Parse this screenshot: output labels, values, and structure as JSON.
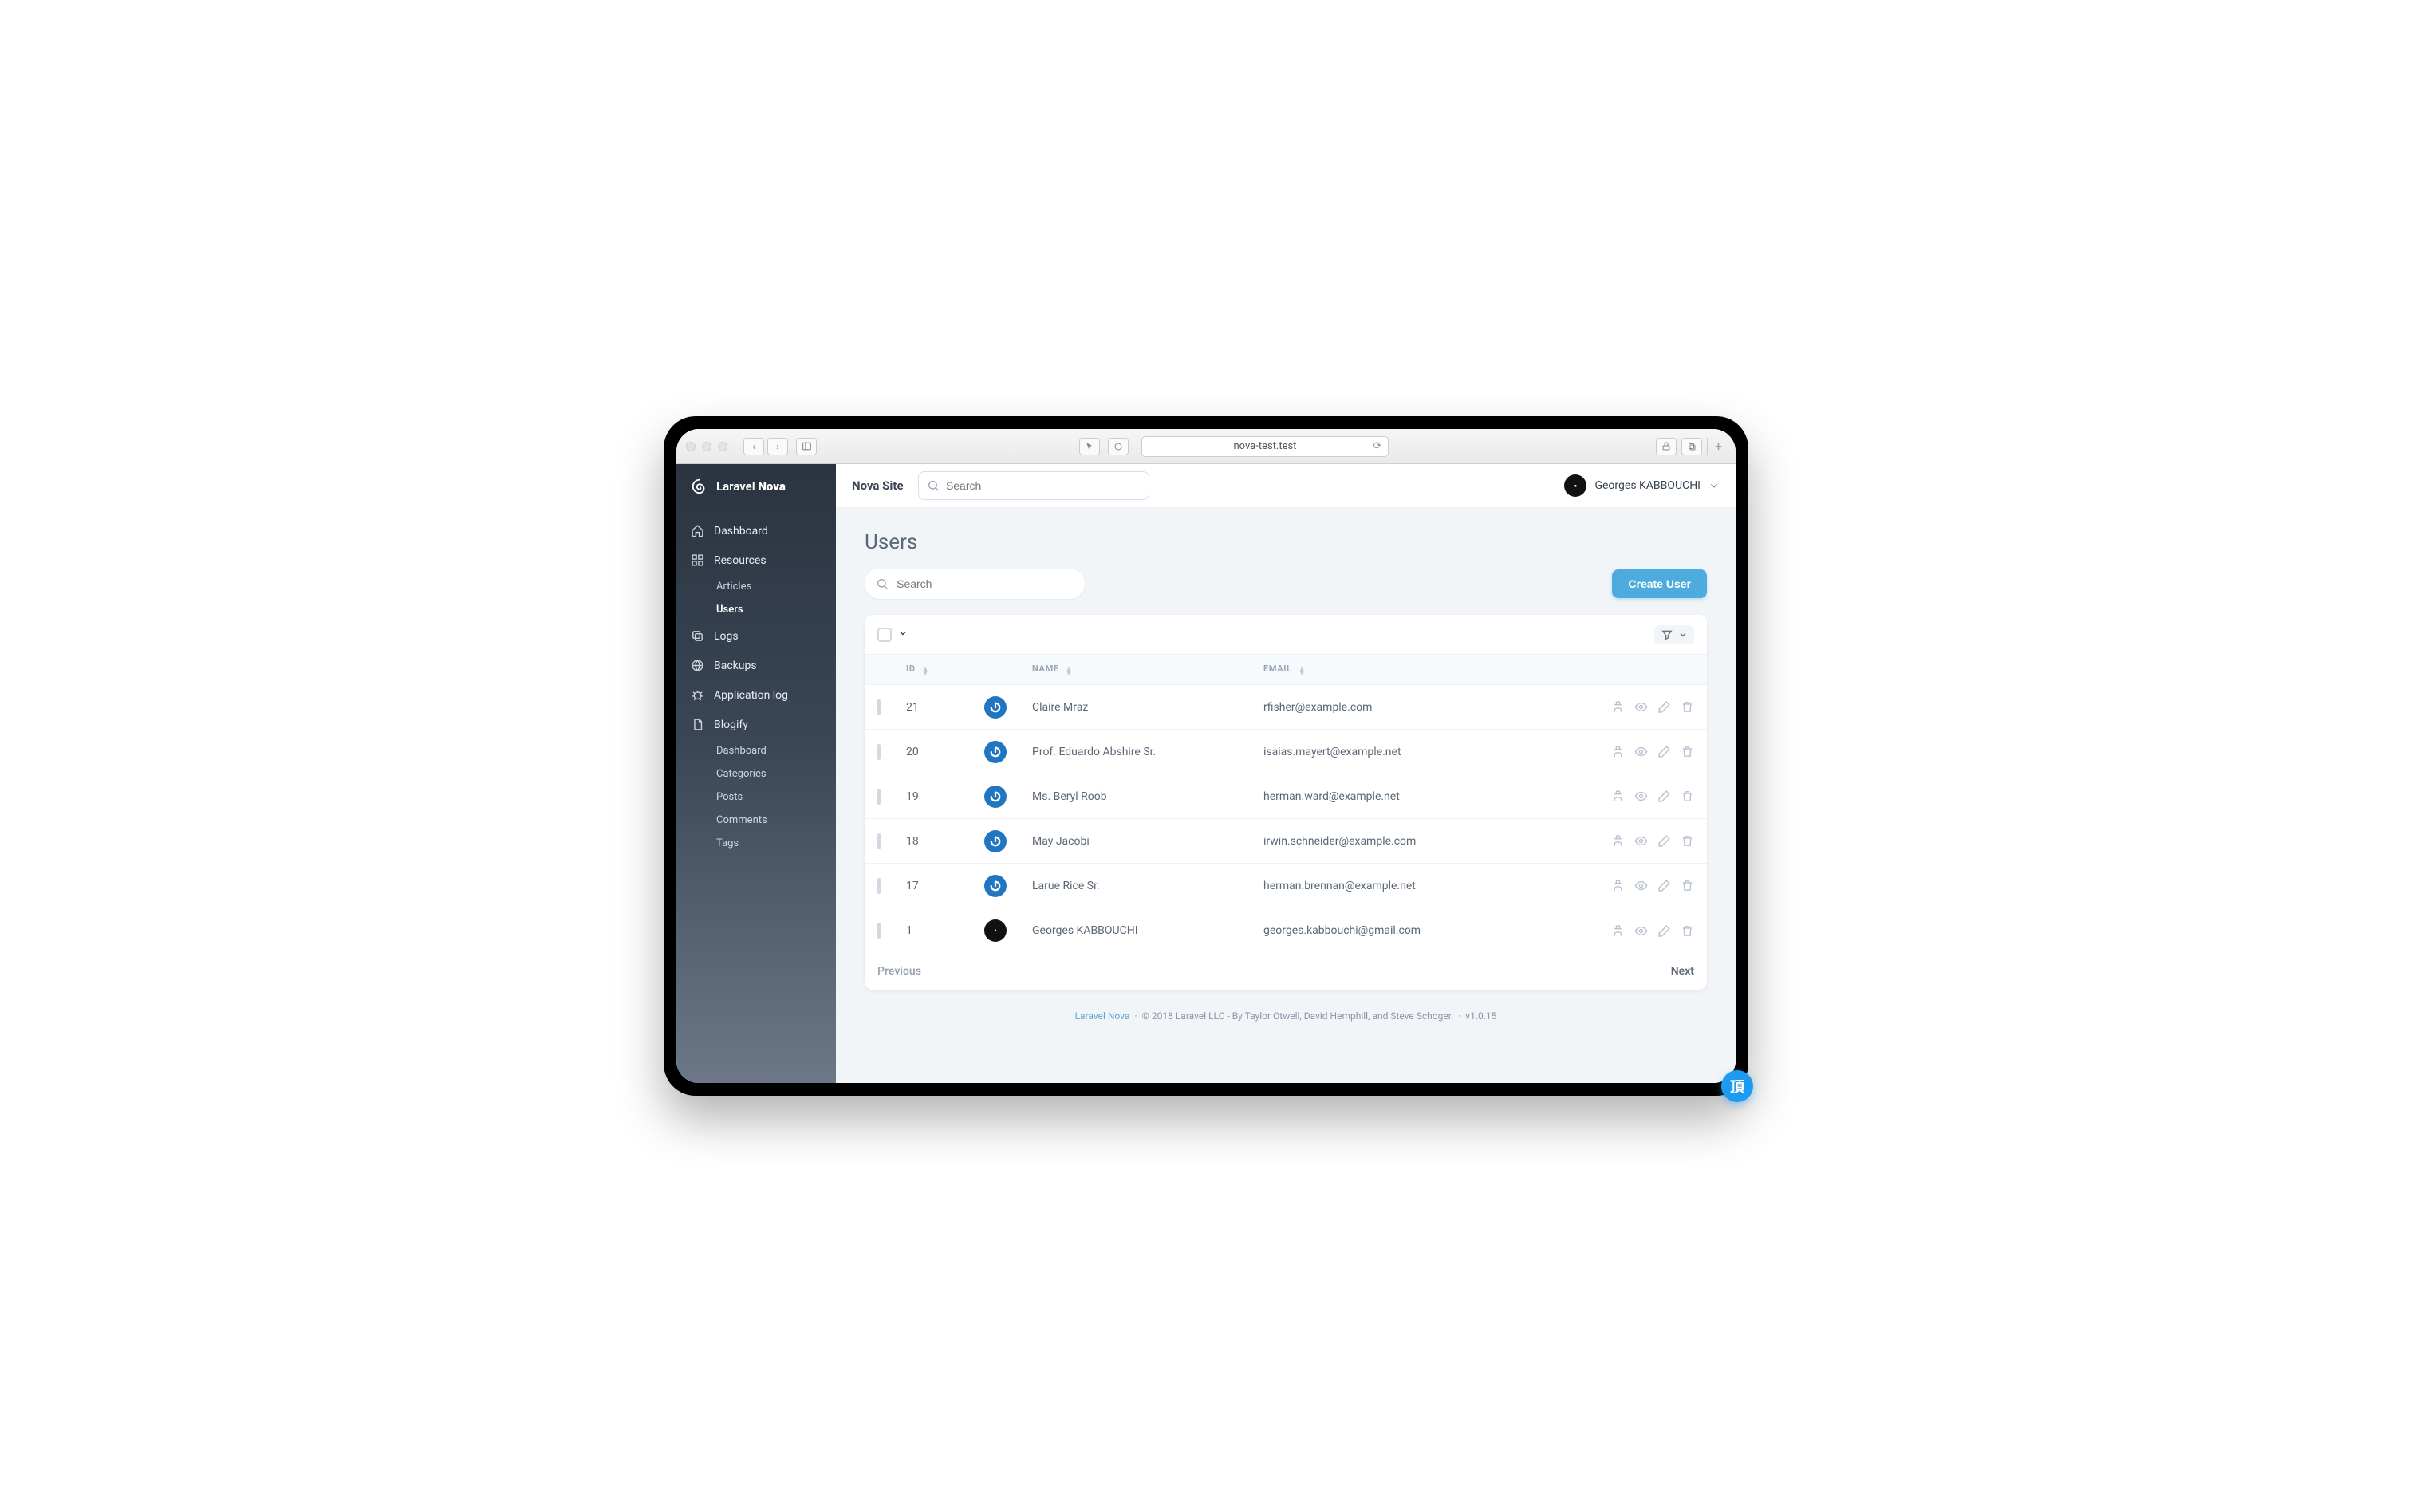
{
  "browser": {
    "url": "nova-test.test"
  },
  "brand": {
    "prefix": "Laravel",
    "name": "Nova"
  },
  "topbar": {
    "site_name": "Nova Site",
    "search_placeholder": "Search",
    "user_name": "Georges KABBOUCHI"
  },
  "sidebar": {
    "dashboard": "Dashboard",
    "resources": "Resources",
    "resources_items": [
      "Articles",
      "Users"
    ],
    "active_resource_index": 1,
    "logs": "Logs",
    "backups": "Backups",
    "app_log": "Application log",
    "blogify": "Blogify",
    "blogify_items": [
      "Dashboard",
      "Categories",
      "Posts",
      "Comments",
      "Tags"
    ]
  },
  "page": {
    "title": "Users",
    "list_search_placeholder": "Search",
    "create_label": "Create User",
    "columns": {
      "id": "ID",
      "name": "NAME",
      "email": "EMAIL"
    },
    "rows": [
      {
        "id": "21",
        "name": "Claire Mraz",
        "email": "rfisher@example.com",
        "avatar": "blue"
      },
      {
        "id": "20",
        "name": "Prof. Eduardo Abshire Sr.",
        "email": "isaias.mayert@example.net",
        "avatar": "blue"
      },
      {
        "id": "19",
        "name": "Ms. Beryl Roob",
        "email": "herman.ward@example.net",
        "avatar": "blue"
      },
      {
        "id": "18",
        "name": "May Jacobi",
        "email": "irwin.schneider@example.com",
        "avatar": "blue"
      },
      {
        "id": "17",
        "name": "Larue Rice Sr.",
        "email": "herman.brennan@example.net",
        "avatar": "blue"
      },
      {
        "id": "1",
        "name": "Georges KABBOUCHI",
        "email": "georges.kabbouchi@gmail.com",
        "avatar": "dark"
      }
    ],
    "pagination": {
      "prev": "Previous",
      "next": "Next"
    }
  },
  "footer": {
    "link": "Laravel Nova",
    "text": "© 2018 Laravel LLC - By Taylor Otwell, David Hemphill, and Steve Schoger.",
    "version": "v1.0.15"
  },
  "corner_badge": "頂"
}
